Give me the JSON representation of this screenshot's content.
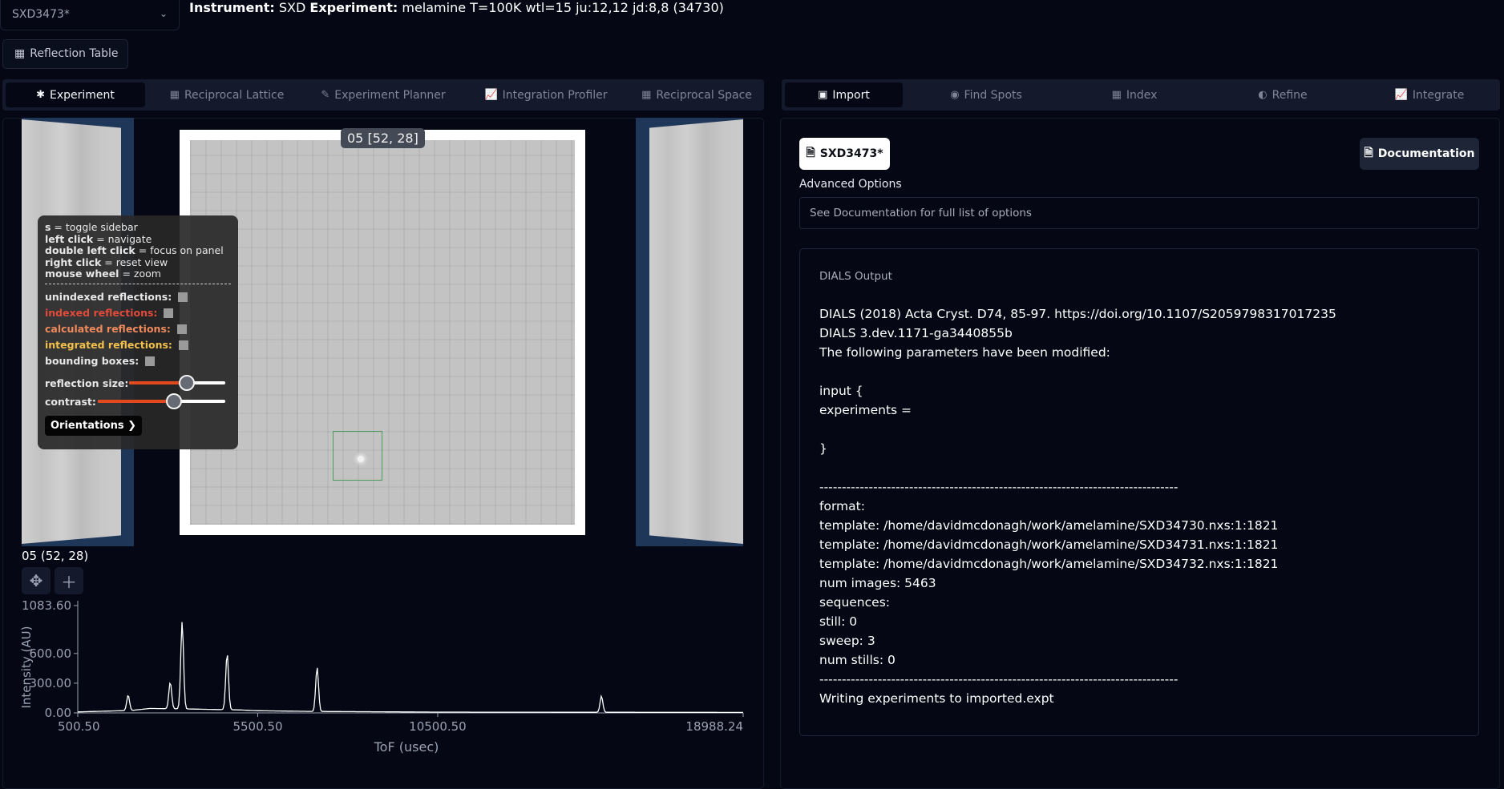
{
  "header": {
    "file_select_value": "SXD3473*",
    "instrument_label": "Instrument:",
    "instrument_value": "SXD",
    "experiment_label": "Experiment:",
    "experiment_value": "melamine T=100K wtl=15 ju:12,12 jd:8,8 (34730)",
    "reflection_table_label": "Reflection Table"
  },
  "left_tabs": [
    {
      "label": "Experiment",
      "icon": "asterisk-icon",
      "active": true
    },
    {
      "label": "Reciprocal Lattice",
      "icon": "grid-icon",
      "active": false
    },
    {
      "label": "Experiment Planner",
      "icon": "pencil-icon",
      "active": false
    },
    {
      "label": "Integration Profiler",
      "icon": "chart-icon",
      "active": false
    },
    {
      "label": "Reciprocal Space",
      "icon": "grid-icon",
      "active": false
    }
  ],
  "right_tabs": [
    {
      "label": "Import",
      "icon": "image-icon",
      "active": true
    },
    {
      "label": "Find Spots",
      "icon": "target-icon",
      "active": false
    },
    {
      "label": "Index",
      "icon": "grid-icon",
      "active": false
    },
    {
      "label": "Refine",
      "icon": "half-circle-icon",
      "active": false
    },
    {
      "label": "Integrate",
      "icon": "chart-icon",
      "active": false
    }
  ],
  "detector": {
    "panel_label": "05 [52, 28]",
    "colors": {
      "side_panel": "#1e3658",
      "roi_box": "#4d9a5b"
    }
  },
  "overlay": {
    "help": [
      {
        "key": "s",
        "text": " = toggle sidebar"
      },
      {
        "key": "left click",
        "text": " = navigate"
      },
      {
        "key": "double left click",
        "text": " = focus on panel"
      },
      {
        "key": "right click",
        "text": " = reset view"
      },
      {
        "key": "mouse wheel",
        "text": " = zoom"
      }
    ],
    "separator": "--------------------------------------------",
    "options": [
      {
        "label": "unindexed reflections:",
        "color": "#e7e7e7"
      },
      {
        "label": "indexed reflections:",
        "color": "#e24a3a"
      },
      {
        "label": "calculated reflections:",
        "color": "#f08a5d"
      },
      {
        "label": "integrated reflections:",
        "color": "#f3c14b"
      },
      {
        "label": "bounding boxes:",
        "color": "#e7e7e7"
      }
    ],
    "sliders": [
      {
        "label": "reflection size:",
        "value": 0.6
      },
      {
        "label": "contrast:",
        "value": 0.6
      }
    ],
    "orientations_label": "Orientations",
    "colors": {
      "slider_fill": "#e24a1e"
    }
  },
  "plot": {
    "title": "05 (52, 28)",
    "tools": [
      "move-icon",
      "plus-icon"
    ]
  },
  "chart_data": {
    "type": "line",
    "xlabel": "ToF (usec)",
    "ylabel": "Intensity (AU)",
    "xlim": [
      500.5,
      18988.24
    ],
    "ylim": [
      0,
      1083.6
    ],
    "xticks": [
      "500.50",
      "5500.50",
      "10500.50",
      "18988.24"
    ],
    "yticks": [
      "1083.60",
      "600.00",
      "300.00",
      "0.00"
    ],
    "grid": false,
    "series": [
      {
        "color": "#ffffff",
        "baseline": [
          [
            500.5,
            10
          ],
          [
            2000,
            25
          ],
          [
            2500,
            45
          ],
          [
            3500,
            40
          ],
          [
            5000,
            30
          ],
          [
            5500,
            22
          ],
          [
            7000,
            15
          ],
          [
            10500,
            8
          ],
          [
            18988.24,
            5
          ]
        ],
        "peaks": [
          {
            "x": 1900,
            "y": 180
          },
          {
            "x": 3070,
            "y": 310
          },
          {
            "x": 3400,
            "y": 920
          },
          {
            "x": 4650,
            "y": 600
          },
          {
            "x": 7150,
            "y": 460
          },
          {
            "x": 15050,
            "y": 170
          }
        ]
      }
    ]
  },
  "right_panel": {
    "file_button": "SXD3473*",
    "documentation_button": "Documentation",
    "advanced_options_label": "Advanced Options",
    "advanced_options_placeholder": "See Documentation for full list of options",
    "output_title": "DIALS Output",
    "output_text": "DIALS (2018) Acta Cryst. D74, 85-97. https://doi.org/10.1107/S2059798317017235\nDIALS 3.dev.1171-ga3440855b\nThe following parameters have been modified:\n\ninput {\nexperiments =\n\n}\n\n--------------------------------------------------------------------------------\nformat:\ntemplate: /home/davidmcdonagh/work/amelamine/SXD34730.nxs:1:1821\ntemplate: /home/davidmcdonagh/work/amelamine/SXD34731.nxs:1:1821\ntemplate: /home/davidmcdonagh/work/amelamine/SXD34732.nxs:1:1821\nnum images: 5463\nsequences:\nstill: 0\nsweep: 3\nnum stills: 0\n--------------------------------------------------------------------------------\nWriting experiments to imported.expt"
  }
}
